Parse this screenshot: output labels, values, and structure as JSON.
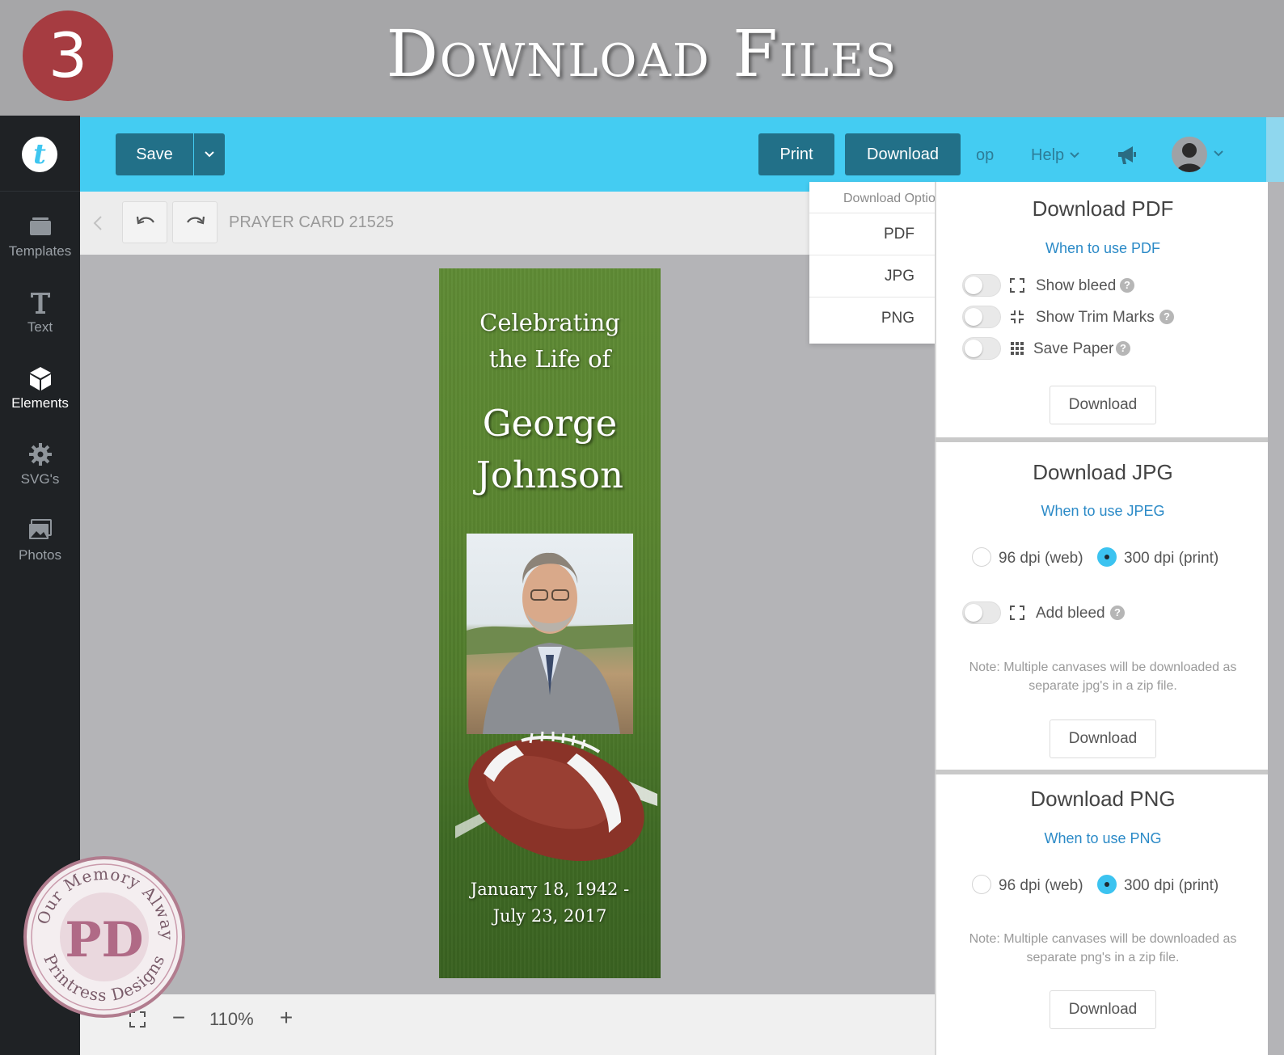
{
  "banner": {
    "step_number": "3",
    "title": "Download Files"
  },
  "sidebar": {
    "logo_letter": "t",
    "items": [
      {
        "label": "Templates",
        "icon": "templates-icon",
        "active": false
      },
      {
        "label": "Text",
        "icon": "text-icon",
        "active": false
      },
      {
        "label": "Elements",
        "icon": "cube-icon",
        "active": true
      },
      {
        "label": "SVG's",
        "icon": "gear-icon",
        "active": false
      },
      {
        "label": "Photos",
        "icon": "photos-icon",
        "active": false
      }
    ]
  },
  "topbar": {
    "save_label": "Save",
    "print_label": "Print",
    "download_label": "Download",
    "partial_text": "op",
    "help_label": "Help",
    "megaphone_icon": "megaphone-icon",
    "accent_color": "#44ccf2",
    "button_color": "#227088"
  },
  "toolbar": {
    "document_title": "PRAYER CARD 21525"
  },
  "card": {
    "heading_line1": "Celebrating",
    "heading_line2": "the Life of",
    "first_name": "George",
    "last_name": "Johnson",
    "dates_line1": "January 18, 1942 -",
    "dates_line2": "July 23, 2017"
  },
  "bottombar": {
    "zoom_level": "110%",
    "zoom_out": "−",
    "zoom_in": "+"
  },
  "dropdown": {
    "header": "Download Options",
    "items": [
      "PDF",
      "JPG",
      "PNG"
    ]
  },
  "pdf_panel": {
    "title": "Download PDF",
    "link": "When to use PDF",
    "options": [
      {
        "label": "Show bleed",
        "enabled": false
      },
      {
        "label": "Show Trim Marks",
        "enabled": false
      },
      {
        "label": "Save Paper",
        "enabled": false
      }
    ],
    "button": "Download"
  },
  "jpg_panel": {
    "title": "Download JPG",
    "link": "When to use JPEG",
    "dpi_options": [
      {
        "label": "96 dpi (web)",
        "selected": false
      },
      {
        "label": "300 dpi (print)",
        "selected": true
      }
    ],
    "bleed_label": "Add bleed",
    "bleed_enabled": false,
    "note": "Note: Multiple canvases will be downloaded as separate jpg's in a zip file.",
    "button": "Download"
  },
  "png_panel": {
    "title": "Download PNG",
    "link": "When to use PNG",
    "dpi_options": [
      {
        "label": "96 dpi (web)",
        "selected": false
      },
      {
        "label": "300 dpi (print)",
        "selected": true
      }
    ],
    "note": "Note: Multiple canvases will be downloaded as separate png's in a zip file.",
    "button": "Download"
  },
  "seal": {
    "top_text": "In Our Memory Always",
    "bottom_text": "Printress Designs",
    "monogram": "PD"
  }
}
